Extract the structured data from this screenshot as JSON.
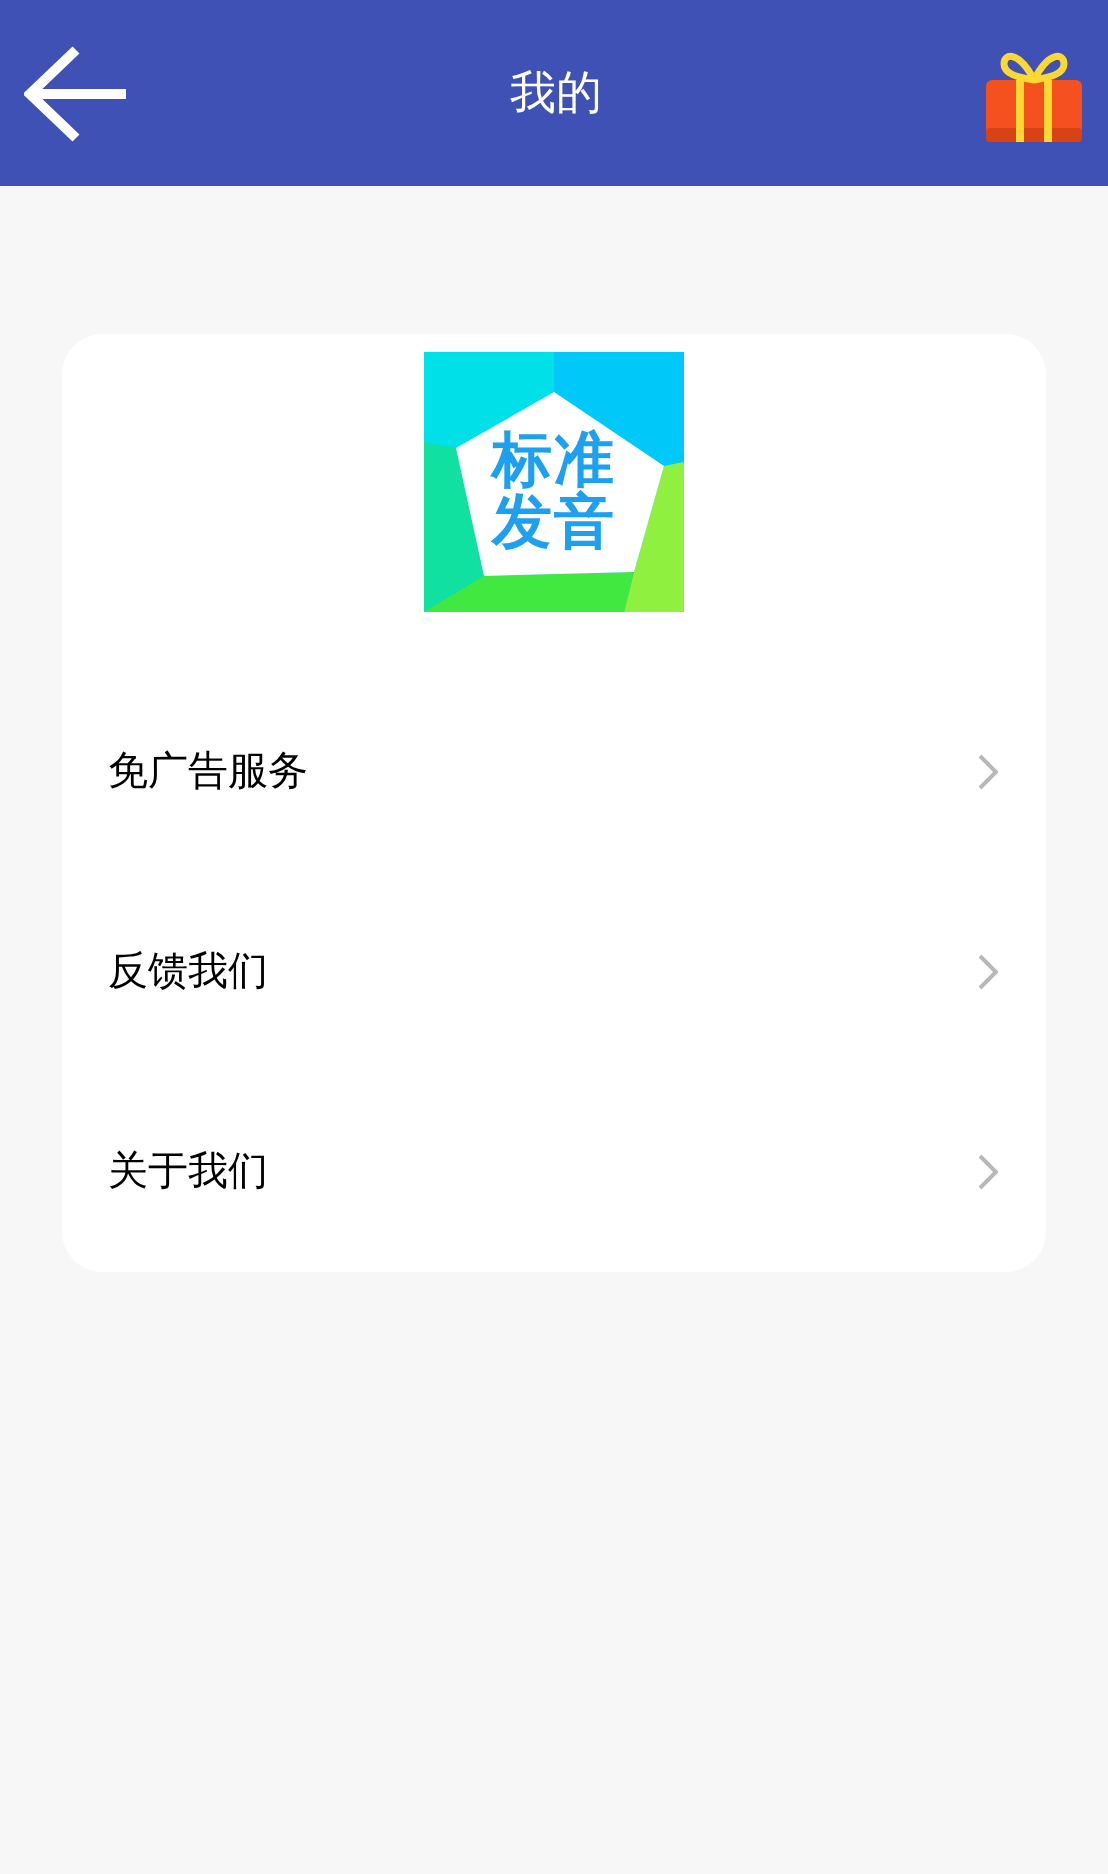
{
  "header": {
    "title": "我的"
  },
  "logo": {
    "lines": [
      "标准",
      "发音"
    ]
  },
  "menu": [
    {
      "label": "免广告服务"
    },
    {
      "label": "反馈我们"
    },
    {
      "label": "关于我们"
    }
  ]
}
